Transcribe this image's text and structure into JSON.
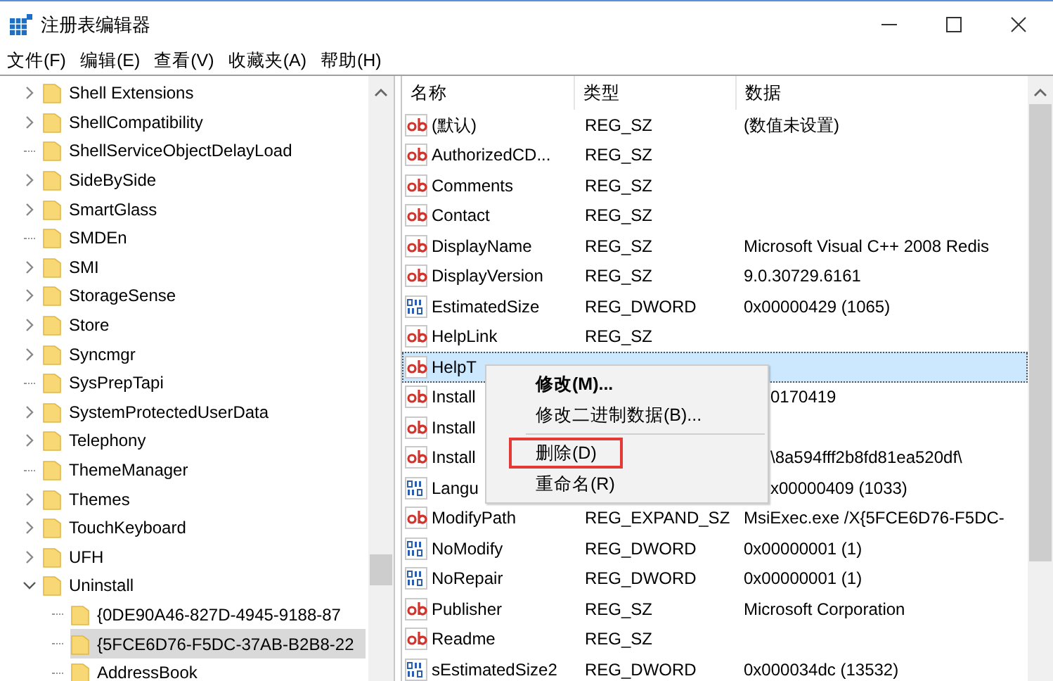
{
  "window": {
    "title": "注册表编辑器"
  },
  "menu_bar": [
    "文件(F)",
    "编辑(E)",
    "查看(V)",
    "收藏夹(A)",
    "帮助(H)"
  ],
  "tree": [
    {
      "label": "Shell Extensions",
      "kind": "branch",
      "expanded": false,
      "selected": false
    },
    {
      "label": "ShellCompatibility",
      "kind": "branch",
      "expanded": false,
      "selected": false
    },
    {
      "label": "ShellServiceObjectDelayLoad",
      "kind": "leaf",
      "selected": false
    },
    {
      "label": "SideBySide",
      "kind": "branch",
      "expanded": false,
      "selected": false
    },
    {
      "label": "SmartGlass",
      "kind": "branch",
      "expanded": false,
      "selected": false
    },
    {
      "label": "SMDEn",
      "kind": "leaf",
      "selected": false
    },
    {
      "label": "SMI",
      "kind": "branch",
      "expanded": false,
      "selected": false
    },
    {
      "label": "StorageSense",
      "kind": "branch",
      "expanded": false,
      "selected": false
    },
    {
      "label": "Store",
      "kind": "branch",
      "expanded": false,
      "selected": false
    },
    {
      "label": "Syncmgr",
      "kind": "branch",
      "expanded": false,
      "selected": false
    },
    {
      "label": "SysPrepTapi",
      "kind": "leaf",
      "selected": false
    },
    {
      "label": "SystemProtectedUserData",
      "kind": "branch",
      "expanded": false,
      "selected": false
    },
    {
      "label": "Telephony",
      "kind": "branch",
      "expanded": false,
      "selected": false
    },
    {
      "label": "ThemeManager",
      "kind": "leaf",
      "selected": false
    },
    {
      "label": "Themes",
      "kind": "branch",
      "expanded": false,
      "selected": false
    },
    {
      "label": "TouchKeyboard",
      "kind": "branch",
      "expanded": false,
      "selected": false
    },
    {
      "label": "UFH",
      "kind": "branch",
      "expanded": false,
      "selected": false
    },
    {
      "label": "Uninstall",
      "kind": "branch",
      "expanded": true,
      "selected": false,
      "children": [
        {
          "label": "{0DE90A46-827D-4945-9188-87",
          "kind": "leaf",
          "selected": false
        },
        {
          "label": "{5FCE6D76-F5DC-37AB-B2B8-22",
          "kind": "leaf",
          "selected": true
        },
        {
          "label": "AddressBook",
          "kind": "leaf",
          "selected": false
        }
      ]
    }
  ],
  "table": {
    "columns": [
      "名称",
      "类型",
      "数据"
    ],
    "rows": [
      {
        "kind": "string",
        "name": "(默认)",
        "type": "REG_SZ",
        "data": "(数值未设置)",
        "selected": false,
        "covered": false
      },
      {
        "kind": "string",
        "name": "AuthorizedCD...",
        "type": "REG_SZ",
        "selected": false
      },
      {
        "kind": "string",
        "name": "Comments",
        "type": "REG_SZ",
        "selected": false
      },
      {
        "kind": "string",
        "name": "Contact",
        "type": "REG_SZ",
        "selected": false
      },
      {
        "kind": "string",
        "name": "DisplayName",
        "type": "REG_SZ",
        "data": "Microsoft Visual C++ 2008 Redis",
        "selected": false,
        "covered": false
      },
      {
        "kind": "string",
        "name": "DisplayVersion",
        "type": "REG_SZ",
        "data": "9.0.30729.6161",
        "selected": false,
        "covered": false
      },
      {
        "kind": "binary",
        "name": "EstimatedSize",
        "type": "REG_DWORD",
        "data": "0x00000429 (1065)",
        "selected": false,
        "covered": false
      },
      {
        "kind": "string",
        "name": "HelpLink",
        "type": "REG_SZ",
        "selected": false
      },
      {
        "kind": "string",
        "name": "HelpT",
        "selected": true
      },
      {
        "kind": "string",
        "name": "Install",
        "data": "0170419",
        "selected": false,
        "covered": true
      },
      {
        "kind": "string",
        "name": "Install",
        "selected": false
      },
      {
        "kind": "string",
        "name": "Install",
        "data": "\\8a594fff2b8fd81ea520df\\",
        "selected": false,
        "covered": true
      },
      {
        "kind": "binary",
        "name": "Langu",
        "data": "x00000409 (1033)",
        "selected": false,
        "covered": true
      },
      {
        "kind": "string",
        "name": "ModifyPath",
        "type": "REG_EXPAND_SZ",
        "data": "MsiExec.exe /X{5FCE6D76-F5DC-",
        "selected": false,
        "covered": false
      },
      {
        "kind": "binary",
        "name": "NoModify",
        "type": "REG_DWORD",
        "data": "0x00000001 (1)",
        "selected": false,
        "covered": false
      },
      {
        "kind": "binary",
        "name": "NoRepair",
        "type": "REG_DWORD",
        "data": "0x00000001 (1)",
        "selected": false,
        "covered": false
      },
      {
        "kind": "string",
        "name": "Publisher",
        "type": "REG_SZ",
        "data": "Microsoft Corporation",
        "selected": false,
        "covered": false
      },
      {
        "kind": "string",
        "name": "Readme",
        "type": "REG_SZ",
        "selected": false
      },
      {
        "kind": "binary",
        "name": "sEstimatedSize2",
        "type": "REG_DWORD",
        "data": "0x000034dc (13532)",
        "selected": false,
        "covered": false
      }
    ]
  },
  "context_menu": [
    {
      "kind": "item",
      "label": "修改(M)...",
      "bold": true,
      "highlighted": false
    },
    {
      "kind": "item",
      "label": "修改二进制数据(B)...",
      "bold": false,
      "highlighted": false
    },
    {
      "kind": "separator"
    },
    {
      "kind": "item",
      "label": "删除(D)",
      "bold": false,
      "highlighted": true
    },
    {
      "kind": "item",
      "label": "重命名(R)",
      "bold": false,
      "highlighted": false
    }
  ]
}
